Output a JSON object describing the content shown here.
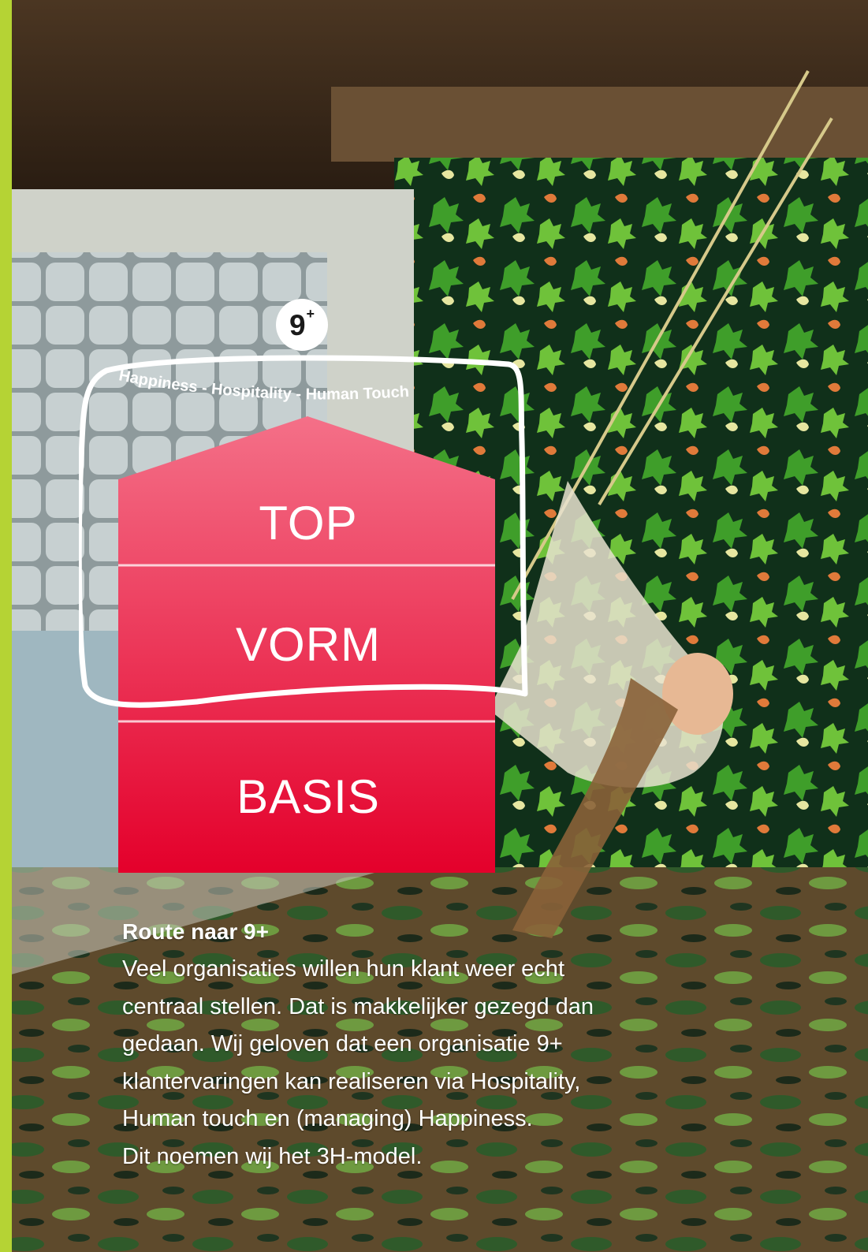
{
  "badge": {
    "number": "9",
    "superscript": "+"
  },
  "model": {
    "tagline": "Happiness - Hospitality - Human Touch",
    "levels": [
      "TOP",
      "VORM",
      "BASIS"
    ]
  },
  "text": {
    "heading": "Route naar 9+",
    "lines": [
      "Veel organisaties willen hun klant weer echt",
      "centraal stellen. Dat is makkelijker gezegd dan",
      "gedaan. Wij geloven dat een organisatie 9+",
      "klantervaringen kan realiseren via Hospitality,",
      "Human touch en (managing) Happiness.",
      "Dit noemen wij het 3H-model."
    ]
  },
  "colors": {
    "accent_bar": "#b5d334",
    "model_top": "#f47088",
    "model_bottom": "#e4002b",
    "text": "#ffffff"
  }
}
